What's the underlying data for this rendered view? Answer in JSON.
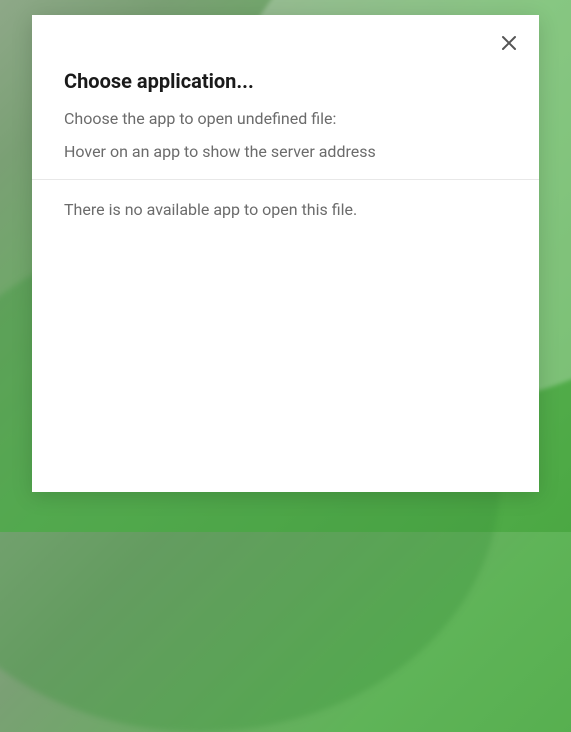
{
  "dialog": {
    "title": "Choose application...",
    "subtitle": "Choose the app to open undefined file:",
    "hint": "Hover on an app to show the server address",
    "empty_message": "There is no available app to open this file."
  }
}
